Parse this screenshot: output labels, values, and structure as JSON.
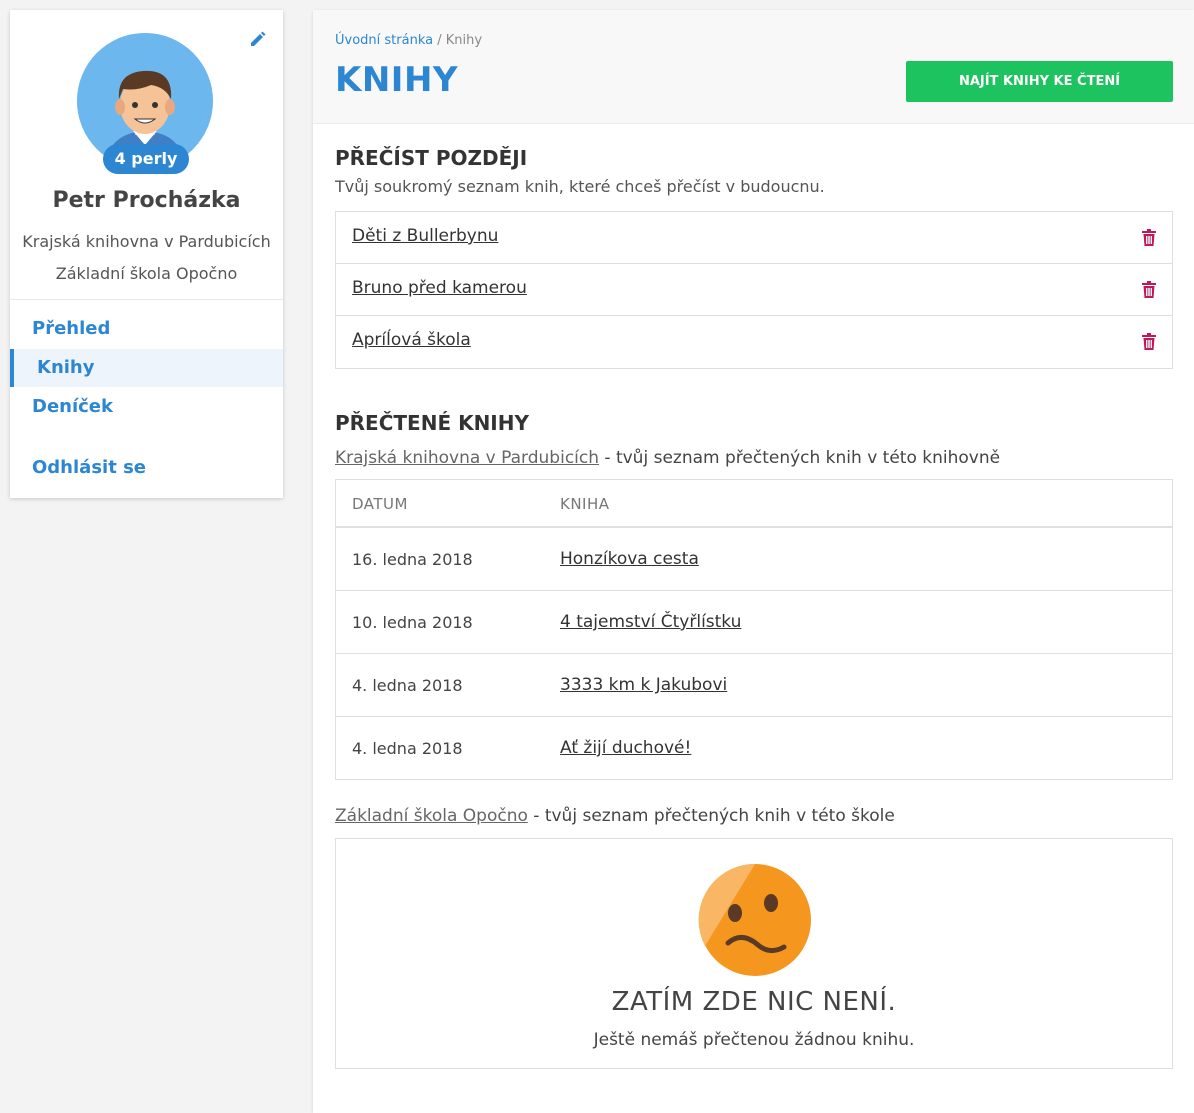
{
  "sidebar": {
    "pearls_badge": "4 perly",
    "user_name": "Petr Procházka",
    "organizations": [
      "Krajská knihovna v Pardubicích",
      "Základní škola Opočno"
    ],
    "nav": {
      "overview": "Přehled",
      "books": "Knihy",
      "diary": "Deníček",
      "logout": "Odhlásit se"
    },
    "active_item": "Knihy"
  },
  "header": {
    "breadcrumb": {
      "home": "Úvodní stránka",
      "separator": " / ",
      "current": "Knihy"
    },
    "title": "KNIHY",
    "find_button": "NAJÍT KNIHY KE ČTENÍ"
  },
  "read_later": {
    "title": "PŘEČÍST POZDĚJI",
    "description": "Tvůj soukromý seznam knih, které chceš přečíst v budoucnu.",
    "books": [
      "Děti z Bullerbynu",
      "Bruno před kamerou",
      "Apríĺová škola"
    ]
  },
  "read_books": {
    "title": "PŘEČTENÉ KNIHY",
    "library": {
      "name": "Krajská knihovna v Pardubicích",
      "suffix": " - tvůj seznam přečtených knih v této knihovně",
      "columns": {
        "date": "DATUM",
        "book": "KNIHA"
      },
      "rows": [
        {
          "date": "16. ledna 2018",
          "book": "Honzíkova cesta"
        },
        {
          "date": "10. ledna 2018",
          "book": "4 tajemství Čtyřlístku"
        },
        {
          "date": "4. ledna 2018",
          "book": "3333 km k Jakubovi"
        },
        {
          "date": "4. ledna 2018",
          "book": "Ať žijí duchové!"
        }
      ]
    },
    "school": {
      "name": "Základní škola Opočno",
      "suffix": " - tvůj seznam přečtených knih v této škole",
      "empty_title": "ZATÍM ZDE NIC NENÍ.",
      "empty_text": "Ještě nemáš přečtenou žádnou knihu."
    }
  },
  "colors": {
    "accent": "#2d86d2",
    "button": "#1dc35f",
    "trash": "#c2185b",
    "sad_face": "#f5961e"
  },
  "icons": [
    "edit-pencil-icon",
    "avatar-boy-icon",
    "trash-icon",
    "sad-face-icon"
  ]
}
